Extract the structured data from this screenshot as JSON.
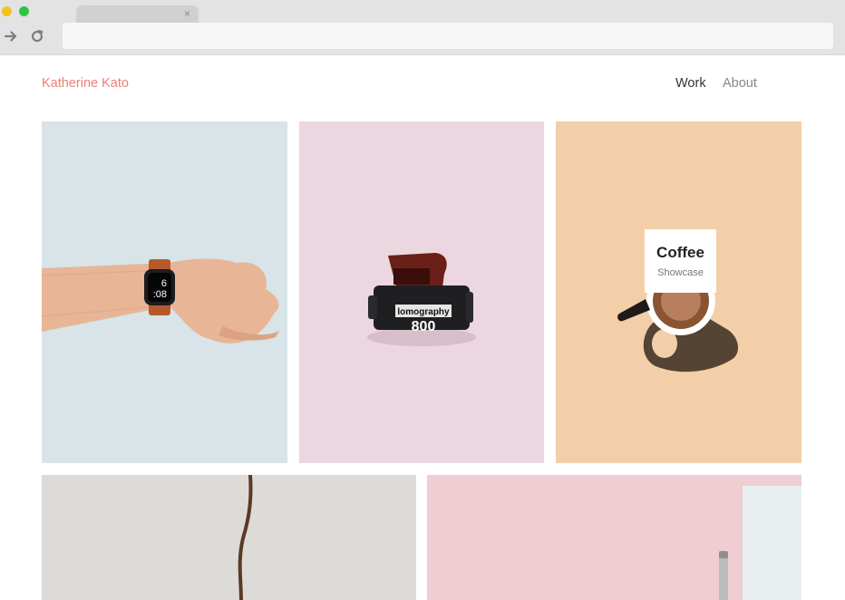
{
  "browser": {
    "tab_close": "×",
    "url": ""
  },
  "site": {
    "brand": "Katherine Kato",
    "nav": [
      {
        "label": "Work"
      },
      {
        "label": "About"
      }
    ]
  },
  "gallery": {
    "watch_display": {
      "line1": "6",
      "line2": ":08"
    },
    "film_label": {
      "brand": "lomography",
      "number": "800"
    },
    "hover_card": {
      "title": "Coffee",
      "subtitle": "Showcase"
    }
  },
  "colors": {
    "brand": "#e98277",
    "watch_bg": "#d8e4e8",
    "film_bg": "#ecd6e0",
    "coffee_bg": "#f2cfa8",
    "rope_bg": "#dddbd7",
    "pink_bg": "#efcdd2"
  }
}
